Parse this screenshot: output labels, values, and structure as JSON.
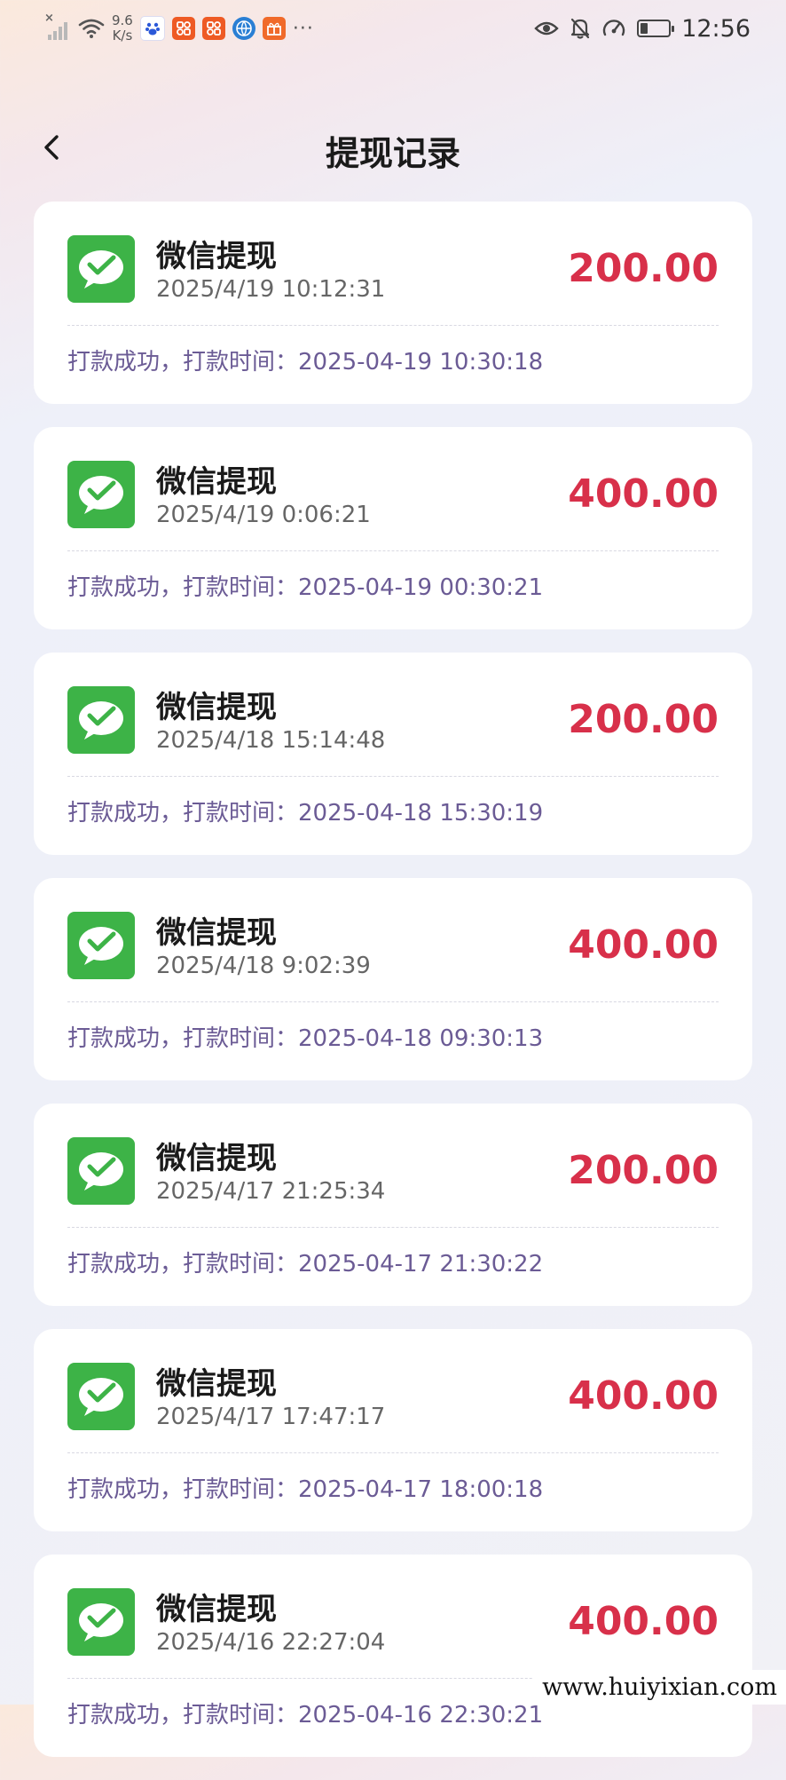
{
  "status_bar": {
    "speed_value": "9.6",
    "speed_unit": "K/s",
    "time": "12:56",
    "more_glyph": "···",
    "battery_percent": 25,
    "icons": [
      "signal-icon",
      "wifi-icon",
      "baidu-icon",
      "app-icon",
      "app-icon",
      "browser-icon",
      "gift-icon",
      "eye-icon",
      "bell-off-icon",
      "speed-icon",
      "battery-icon"
    ]
  },
  "header": {
    "title": "提现记录",
    "back_icon": "chevron-left-icon"
  },
  "records": [
    {
      "title": "微信提现",
      "time": "2025/4/19 10:12:31",
      "amount": "200.00",
      "status": "打款成功，打款时间：2025-04-19 10:30:18"
    },
    {
      "title": "微信提现",
      "time": "2025/4/19 0:06:21",
      "amount": "400.00",
      "status": "打款成功，打款时间：2025-04-19 00:30:21"
    },
    {
      "title": "微信提现",
      "time": "2025/4/18 15:14:48",
      "amount": "200.00",
      "status": "打款成功，打款时间：2025-04-18 15:30:19"
    },
    {
      "title": "微信提现",
      "time": "2025/4/18 9:02:39",
      "amount": "400.00",
      "status": "打款成功，打款时间：2025-04-18 09:30:13"
    },
    {
      "title": "微信提现",
      "time": "2025/4/17 21:25:34",
      "amount": "200.00",
      "status": "打款成功，打款时间：2025-04-17 21:30:22"
    },
    {
      "title": "微信提现",
      "time": "2025/4/17 17:47:17",
      "amount": "400.00",
      "status": "打款成功，打款时间：2025-04-17 18:00:18"
    },
    {
      "title": "微信提现",
      "time": "2025/4/16 22:27:04",
      "amount": "400.00",
      "status": "打款成功，打款时间：2025-04-16 22:30:21"
    }
  ],
  "colors": {
    "amount": "#d8304a",
    "status_text": "#6b5b95",
    "wechat_green": "#3db347"
  },
  "watermark": "www.huiyixian.com"
}
